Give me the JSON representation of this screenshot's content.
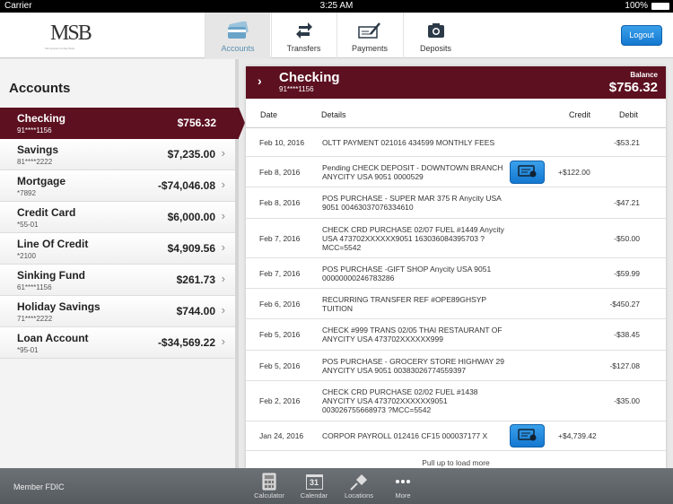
{
  "status_bar": {
    "carrier": "Carrier",
    "time": "3:25 AM",
    "battery": "100%"
  },
  "header": {
    "logo": "MSB",
    "logo_tagline": "Metropolitan Savings Bank",
    "tabs": [
      {
        "label": "Accounts",
        "icon": "credit-card-icon",
        "active": true
      },
      {
        "label": "Transfers",
        "icon": "transfer-arrows-icon"
      },
      {
        "label": "Payments",
        "icon": "check-pen-icon"
      },
      {
        "label": "Deposits",
        "icon": "camera-icon"
      }
    ],
    "logout": "Logout"
  },
  "accounts": {
    "title": "Accounts",
    "items": [
      {
        "name": "Checking",
        "number": "91****1156",
        "balance": "$756.32",
        "active": true
      },
      {
        "name": "Savings",
        "number": "81****2222",
        "balance": "$7,235.00"
      },
      {
        "name": "Mortgage",
        "number": "*7892",
        "balance": "-$74,046.08"
      },
      {
        "name": "Credit Card",
        "number": "*55-01",
        "balance": "$6,000.00"
      },
      {
        "name": "Line Of Credit",
        "number": "*2100",
        "balance": "$4,909.56"
      },
      {
        "name": "Sinking Fund",
        "number": "61****1156",
        "balance": "$261.73"
      },
      {
        "name": "Holiday Savings",
        "number": "71****2222",
        "balance": "$744.00"
      },
      {
        "name": "Loan Account",
        "number": "*95-01",
        "balance": "-$34,569.22"
      }
    ]
  },
  "detail": {
    "name": "Checking",
    "number": "91****1156",
    "balance_label": "Balance",
    "balance": "$756.32",
    "columns": {
      "date": "Date",
      "details": "Details",
      "credit": "Credit",
      "debit": "Debit"
    },
    "transactions": [
      {
        "date": "Feb 10, 2016",
        "details": "OLTT PAYMENT 021016 434599 MONTHLY FEES",
        "credit": "",
        "debit": "-$53.21",
        "h": 32
      },
      {
        "date": "Feb 8, 2016",
        "details": "Pending CHECK DEPOSIT - DOWNTOWN BRANCH ANYCITY USA 9051 0000529",
        "credit": "+$122.00",
        "debit": "",
        "image": true,
        "h": 34
      },
      {
        "date": "Feb 8, 2016",
        "details": "POS PURCHASE -  SUPER MAR 375 R Anycity USA 9051 00463037076334610",
        "credit": "",
        "debit": "-$47.21",
        "h": 35
      },
      {
        "date": "Feb 7, 2016",
        "details": "CHECK CRD PURCHASE 02/07  FUEL #1449 Anycity USA 473702XXXXXX9051 163036084395703 ?MCC=5542",
        "credit": "",
        "debit": "-$50.00",
        "h": 44
      },
      {
        "date": "Feb 7, 2016",
        "details": "POS PURCHASE -GIFT SHOP Anycity USA 9051 00000000246783286",
        "credit": "",
        "debit": "-$59.99",
        "h": 34
      },
      {
        "date": "Feb 6, 2016",
        "details": "RECURRING TRANSFER REF #OPE89GHSYP TUITION",
        "credit": "",
        "debit": "-$450.27",
        "h": 34
      },
      {
        "date": "Feb 5, 2016",
        "details": "CHECK #999 TRANS 02/05 THAI RESTAURANT OF ANYCITY USA 473702XXXXXX999",
        "credit": "",
        "debit": "-$38.45",
        "h": 35
      },
      {
        "date": "Feb 5, 2016",
        "details": "POS PURCHASE - GROCERY STORE HIGHWAY 29 ANYCITY USA 9051 00383026774559397",
        "credit": "",
        "debit": "-$127.08",
        "h": 34
      },
      {
        "date": "Feb 2, 2016",
        "details": "CHECK CRD PURCHASE 02/02 FUEL #1438 ANYCITY USA 473702XXXXXX9051 003026755668973 ?MCC=5542",
        "credit": "",
        "debit": "-$35.00",
        "h": 45
      },
      {
        "date": "Jan 24, 2016",
        "details": "CORPOR PAYROLL 012416 CF15 000037177 X",
        "credit": "+$4,739.42",
        "debit": "",
        "image": true,
        "h": 33
      }
    ],
    "load_more": "Pull up to load more"
  },
  "footer": {
    "fdic": "Member FDIC",
    "tools": [
      {
        "label": "Calculator",
        "icon": "calculator-icon"
      },
      {
        "label": "Calendar",
        "icon": "calendar-icon",
        "day": "31"
      },
      {
        "label": "Locations",
        "icon": "pushpin-icon"
      },
      {
        "label": "More",
        "icon": "more-dots-icon"
      }
    ]
  },
  "colors": {
    "brand": "#5c1020",
    "accent": "#1a86dc"
  }
}
